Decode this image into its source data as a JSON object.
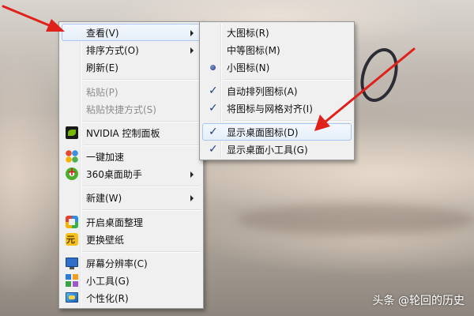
{
  "context_menu": {
    "items": [
      {
        "label": "查看(V)",
        "has_submenu": true,
        "highlighted": true
      },
      {
        "label": "排序方式(O)",
        "has_submenu": true
      },
      {
        "label": "刷新(E)"
      },
      {
        "label": "粘贴(P)",
        "disabled": true
      },
      {
        "label": "粘贴快捷方式(S)",
        "disabled": true
      },
      {
        "label": "NVIDIA 控制面板",
        "icon": "nvidia-icon"
      },
      {
        "label": "一键加速",
        "icon": "speedup-icon"
      },
      {
        "label": "360桌面助手",
        "icon": "360-desktop-icon",
        "has_submenu": true
      },
      {
        "label": "新建(W)",
        "has_submenu": true
      },
      {
        "label": "开启桌面整理",
        "icon": "desktop-organize-icon"
      },
      {
        "label": "更换壁纸",
        "icon": "wallpaper-icon"
      },
      {
        "label": "屏幕分辨率(C)",
        "icon": "screen-resolution-icon"
      },
      {
        "label": "小工具(G)",
        "icon": "gadgets-icon"
      },
      {
        "label": "个性化(R)",
        "icon": "personalize-icon"
      }
    ]
  },
  "view_submenu": {
    "items": [
      {
        "label": "大图标(R)"
      },
      {
        "label": "中等图标(M)"
      },
      {
        "label": "小图标(N)",
        "radio_selected": true
      },
      {
        "label": "自动排列图标(A)",
        "checked": true
      },
      {
        "label": "将图标与网格对齐(I)",
        "checked": true
      },
      {
        "label": "显示桌面图标(D)",
        "checked": true,
        "highlighted": true
      },
      {
        "label": "显示桌面小工具(G)",
        "checked": true
      }
    ]
  },
  "annotation_color": "#e0201a",
  "watermark": "头条 @轮回的历史"
}
